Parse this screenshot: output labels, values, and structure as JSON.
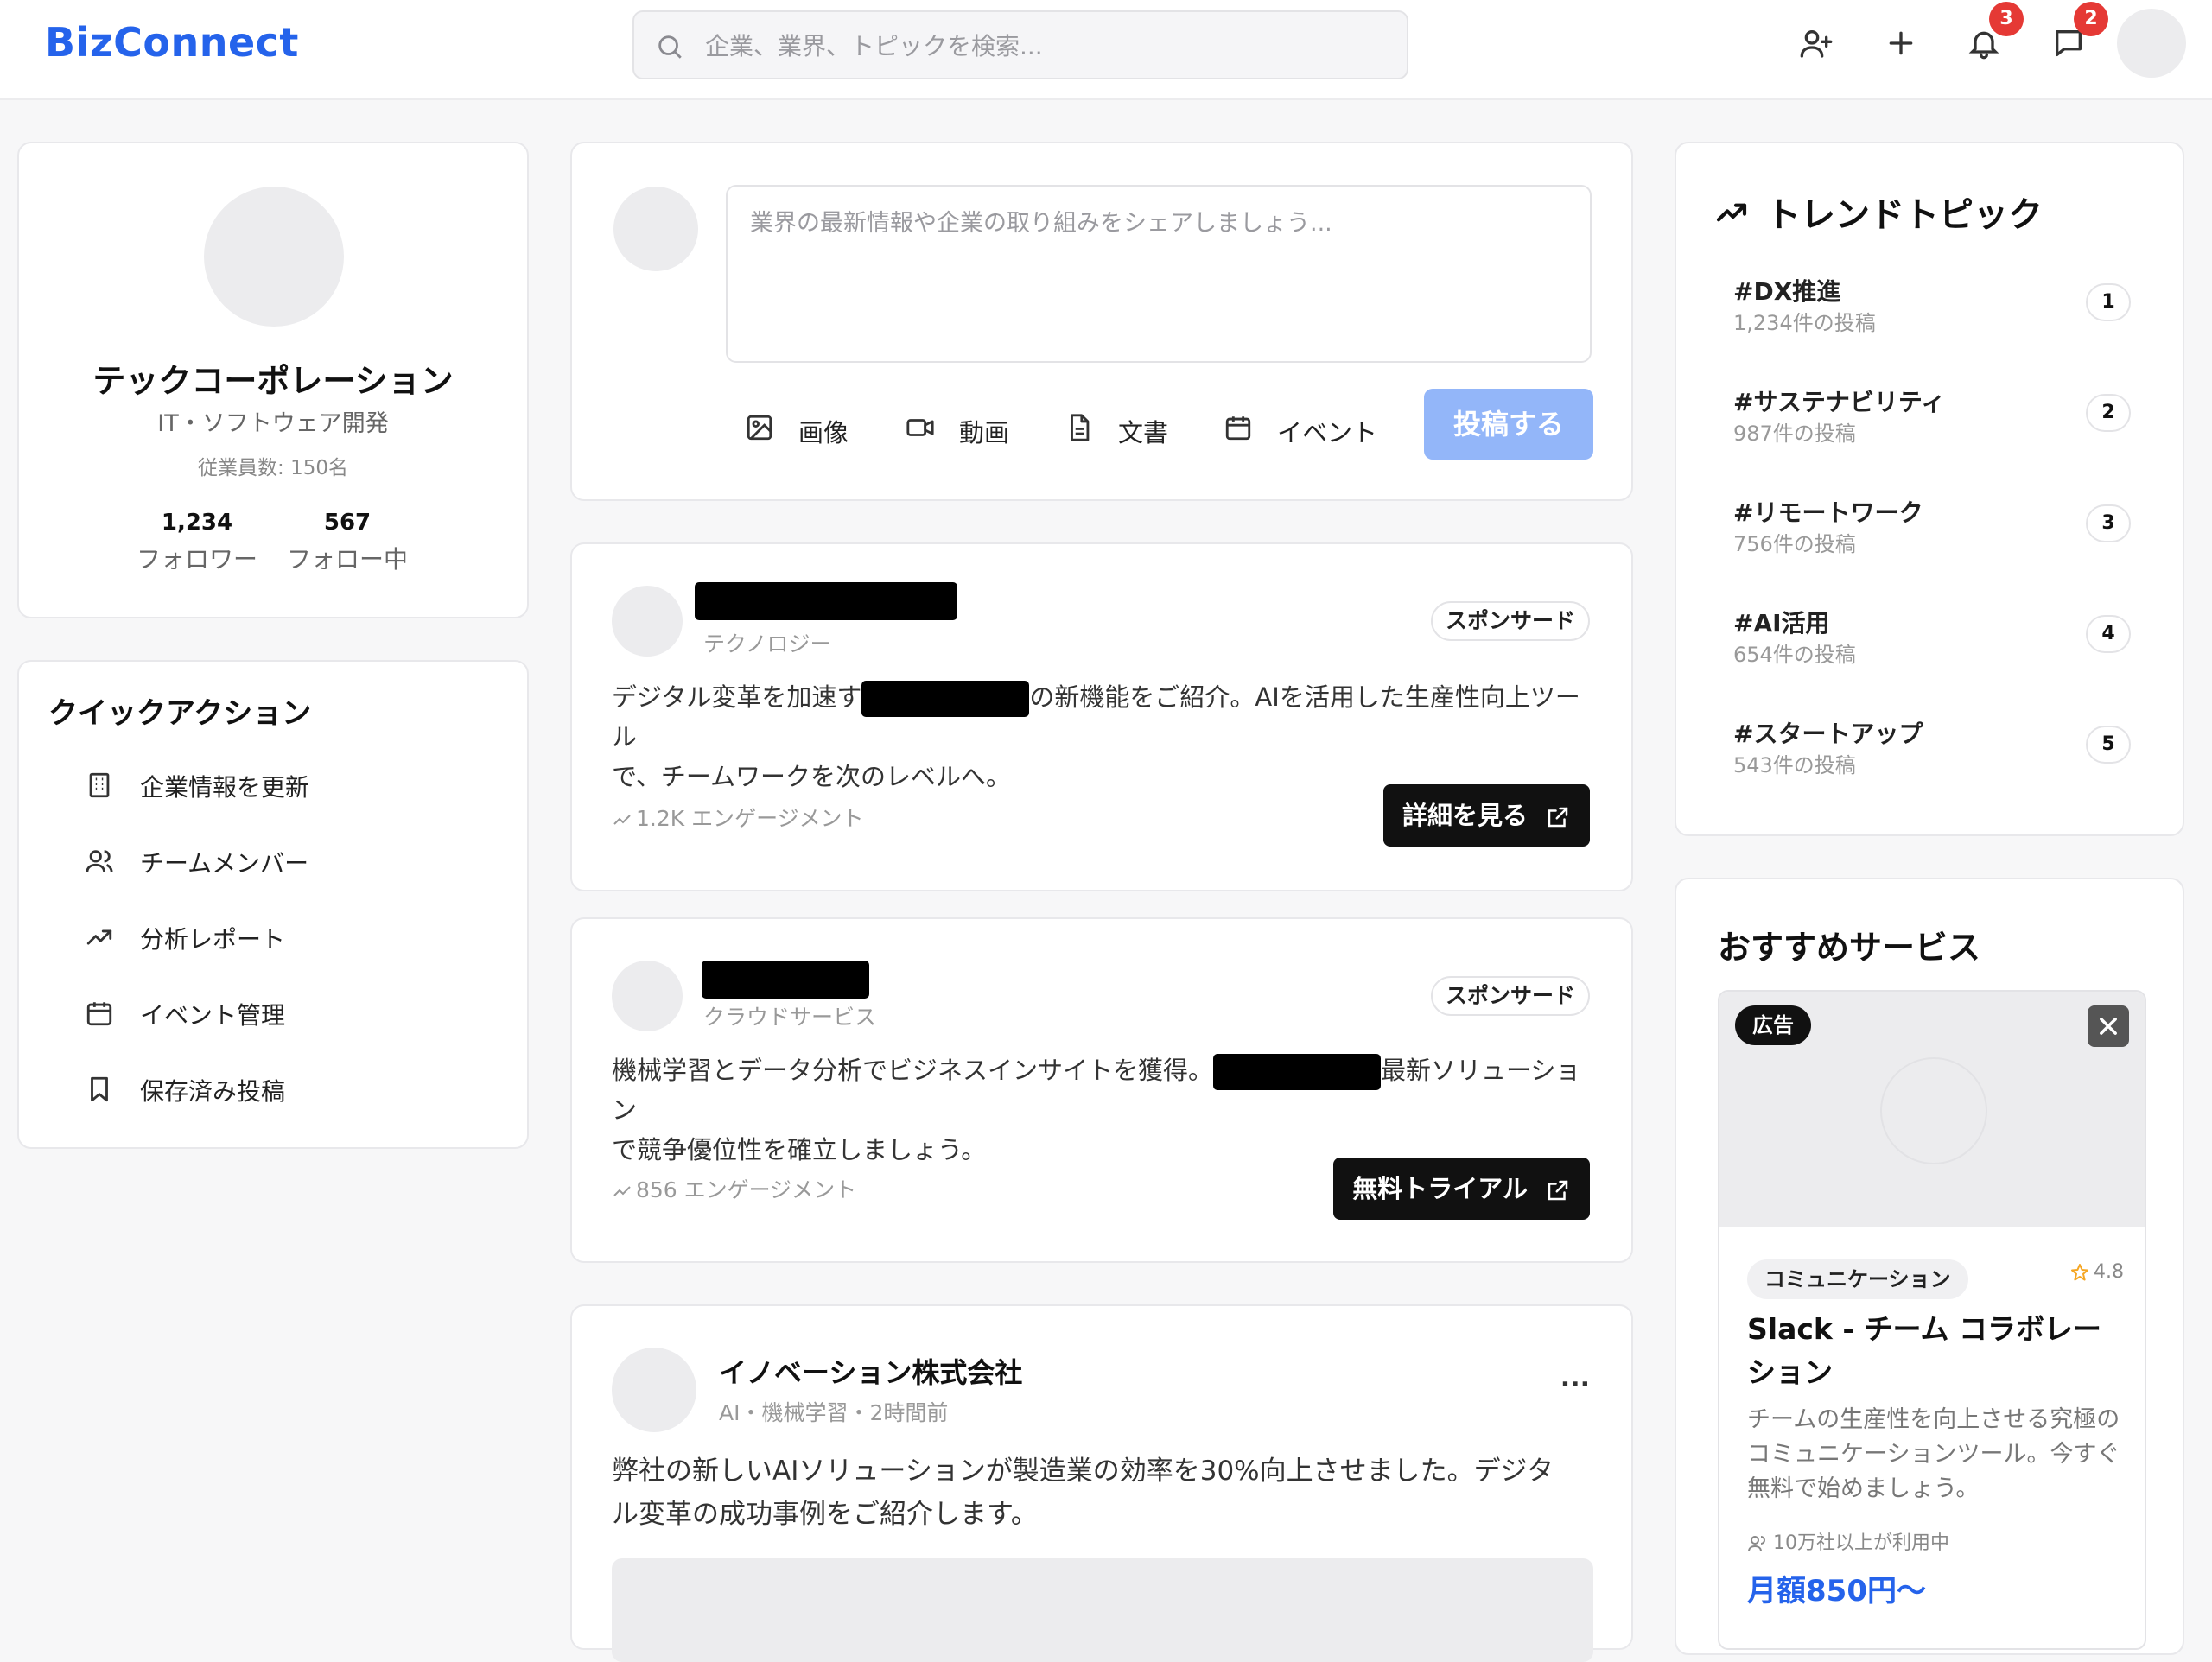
{
  "header": {
    "logo": "BizConnect",
    "search_placeholder": "企業、業界、トピックを検索...",
    "notifications_count": "3",
    "messages_count": "2"
  },
  "profile": {
    "name": "テックコーポレーション",
    "industry": "IT・ソフトウェア開発",
    "employees": "従業員数: 150名",
    "followers_count": "1,234",
    "followers_label": "フォロワー",
    "following_count": "567",
    "following_label": "フォロー中"
  },
  "quick_actions": {
    "title": "クイックアクション",
    "items": [
      {
        "label": "企業情報を更新",
        "icon": "building-icon"
      },
      {
        "label": "チームメンバー",
        "icon": "users-icon"
      },
      {
        "label": "分析レポート",
        "icon": "trending-up-icon"
      },
      {
        "label": "イベント管理",
        "icon": "calendar-icon"
      },
      {
        "label": "保存済み投稿",
        "icon": "bookmark-icon"
      }
    ]
  },
  "composer": {
    "placeholder": "業界の最新情報や企業の取り組みをシェアしましょう...",
    "image_label": "画像",
    "video_label": "動画",
    "document_label": "文書",
    "event_label": "イベント",
    "post_button": "投稿する"
  },
  "posts": [
    {
      "category": "テクノロジー",
      "badge": "スポンサード",
      "body_line1_pre": "デジタル変革を加速す",
      "body_line1_post": "の新機能をご紹介。AIを活用した生産性向上ツール",
      "body_line2": "で、チームワークを次のレベルへ。",
      "engagement": "1.2K エンゲージメント",
      "cta": "詳細を見る"
    },
    {
      "category": "クラウドサービス",
      "badge": "スポンサード",
      "body_line1_pre": "機械学習とデータ分析でビジネスインサイトを獲得。",
      "body_line1_post": "最新ソリューション",
      "body_line2": "で競争優位性を確立しましょう。",
      "engagement": "856 エンゲージメント",
      "cta": "無料トライアル"
    },
    {
      "author": "イノベーション株式会社",
      "meta": "AI・機械学習・2時間前",
      "more": "...",
      "body_line1": "弊社の新しいAIソリューションが製造業の効率を30%向上させました。デジタ",
      "body_line2": "ル変革の成功事例をご紹介します。"
    }
  ],
  "trending": {
    "title": "トレンドトピック",
    "items": [
      {
        "tag": "#DX推進",
        "count": "1,234件の投稿",
        "rank": "1"
      },
      {
        "tag": "#サステナビリティ",
        "count": "987件の投稿",
        "rank": "2"
      },
      {
        "tag": "#リモートワーク",
        "count": "756件の投稿",
        "rank": "3"
      },
      {
        "tag": "#AI活用",
        "count": "654件の投稿",
        "rank": "4"
      },
      {
        "tag": "#スタートアップ",
        "count": "543件の投稿",
        "rank": "5"
      }
    ]
  },
  "recommended": {
    "title": "おすすめサービス",
    "ad_badge": "広告",
    "category": "コミュニケーション",
    "rating": "4.8",
    "name": "Slack - チーム コラボレーション",
    "description": "チームの生産性を向上させる究極のコミュニケーションツール。今すぐ無料で始めましょう。",
    "users": "10万社以上が利用中",
    "price": "月額850円〜"
  },
  "colors": {
    "brand": "#2563eb",
    "badge": "#e53935",
    "post_button": "#93b6f9"
  }
}
